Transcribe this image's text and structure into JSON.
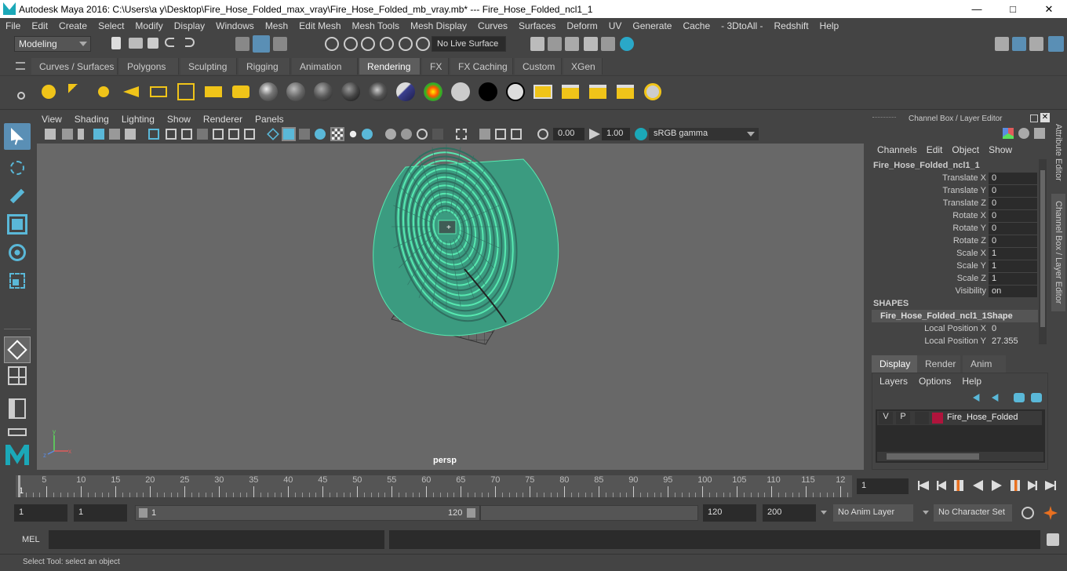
{
  "titlebar": {
    "text": "Autodesk Maya 2016: C:\\Users\\a y\\Desktop\\Fire_Hose_Folded_max_vray\\Fire_Hose_Folded_mb_vray.mb*   ---   Fire_Hose_Folded_ncl1_1",
    "minimize": "—",
    "maximize": "□",
    "close": "✕"
  },
  "menubar": [
    "File",
    "Edit",
    "Create",
    "Select",
    "Modify",
    "Display",
    "Windows",
    "Mesh",
    "Edit Mesh",
    "Mesh Tools",
    "Mesh Display",
    "Curves",
    "Surfaces",
    "Deform",
    "UV",
    "Generate",
    "Cache",
    "- 3DtoAll -",
    "Redshift",
    "Help"
  ],
  "statusline": {
    "mode": "Modeling",
    "live_surface": "No Live Surface"
  },
  "shelf_tabs": [
    {
      "label": "Curves / Surfaces",
      "active": false
    },
    {
      "label": "Polygons",
      "active": false
    },
    {
      "label": "Sculpting",
      "active": false
    },
    {
      "label": "Rigging",
      "active": false
    },
    {
      "label": "Animation",
      "active": false
    },
    {
      "label": "Rendering",
      "active": true
    },
    {
      "label": "FX",
      "active": false
    },
    {
      "label": "FX Caching",
      "active": false
    },
    {
      "label": "Custom",
      "active": false
    },
    {
      "label": "XGen",
      "active": false
    }
  ],
  "viewport": {
    "menu": [
      "View",
      "Shading",
      "Lighting",
      "Show",
      "Renderer",
      "Panels"
    ],
    "exposure": "0.00",
    "gamma": "1.00",
    "color_space": "sRGB gamma",
    "camera": "persp",
    "wire_color": "#57e8b0"
  },
  "channel_box": {
    "header": "Channel Box / Layer Editor",
    "menu": [
      "Channels",
      "Edit",
      "Object",
      "Show"
    ],
    "object_name": "Fire_Hose_Folded_ncl1_1",
    "attributes": [
      {
        "name": "Translate X",
        "value": "0"
      },
      {
        "name": "Translate Y",
        "value": "0"
      },
      {
        "name": "Translate Z",
        "value": "0"
      },
      {
        "name": "Rotate X",
        "value": "0"
      },
      {
        "name": "Rotate Y",
        "value": "0"
      },
      {
        "name": "Rotate Z",
        "value": "0"
      },
      {
        "name": "Scale X",
        "value": "1"
      },
      {
        "name": "Scale Y",
        "value": "1"
      },
      {
        "name": "Scale Z",
        "value": "1"
      },
      {
        "name": "Visibility",
        "value": "on"
      }
    ],
    "shapes_header": "SHAPES",
    "shape_name": "Fire_Hose_Folded_ncl1_1Shape",
    "shape_attributes": [
      {
        "name": "Local Position X",
        "value": "0"
      },
      {
        "name": "Local Position Y",
        "value": "27.355"
      }
    ]
  },
  "layer_editor": {
    "tabs": [
      "Display",
      "Render",
      "Anim"
    ],
    "menu": [
      "Layers",
      "Options",
      "Help"
    ],
    "layer": {
      "v": "V",
      "p": "P",
      "name": "Fire_Hose_Folded",
      "color": "#b0143c"
    }
  },
  "side_tabs": [
    "Attribute Editor",
    "Channel Box / Layer Editor"
  ],
  "timeline": {
    "labels": [
      "5",
      "10",
      "15",
      "20",
      "25",
      "30",
      "35",
      "40",
      "45",
      "50",
      "55",
      "60",
      "65",
      "70",
      "75",
      "80",
      "85",
      "90",
      "95",
      "100",
      "105",
      "110",
      "115",
      "12"
    ],
    "start_marker": "1",
    "current_frame": "1"
  },
  "range": {
    "start": "1",
    "playback_start": "1",
    "slider_start": "1",
    "slider_end": "120",
    "playback_end": "120",
    "end": "200",
    "anim_layer": "No Anim Layer",
    "character_set": "No Character Set"
  },
  "command_line": {
    "label": "MEL"
  },
  "help_line": "Select Tool: select an object"
}
